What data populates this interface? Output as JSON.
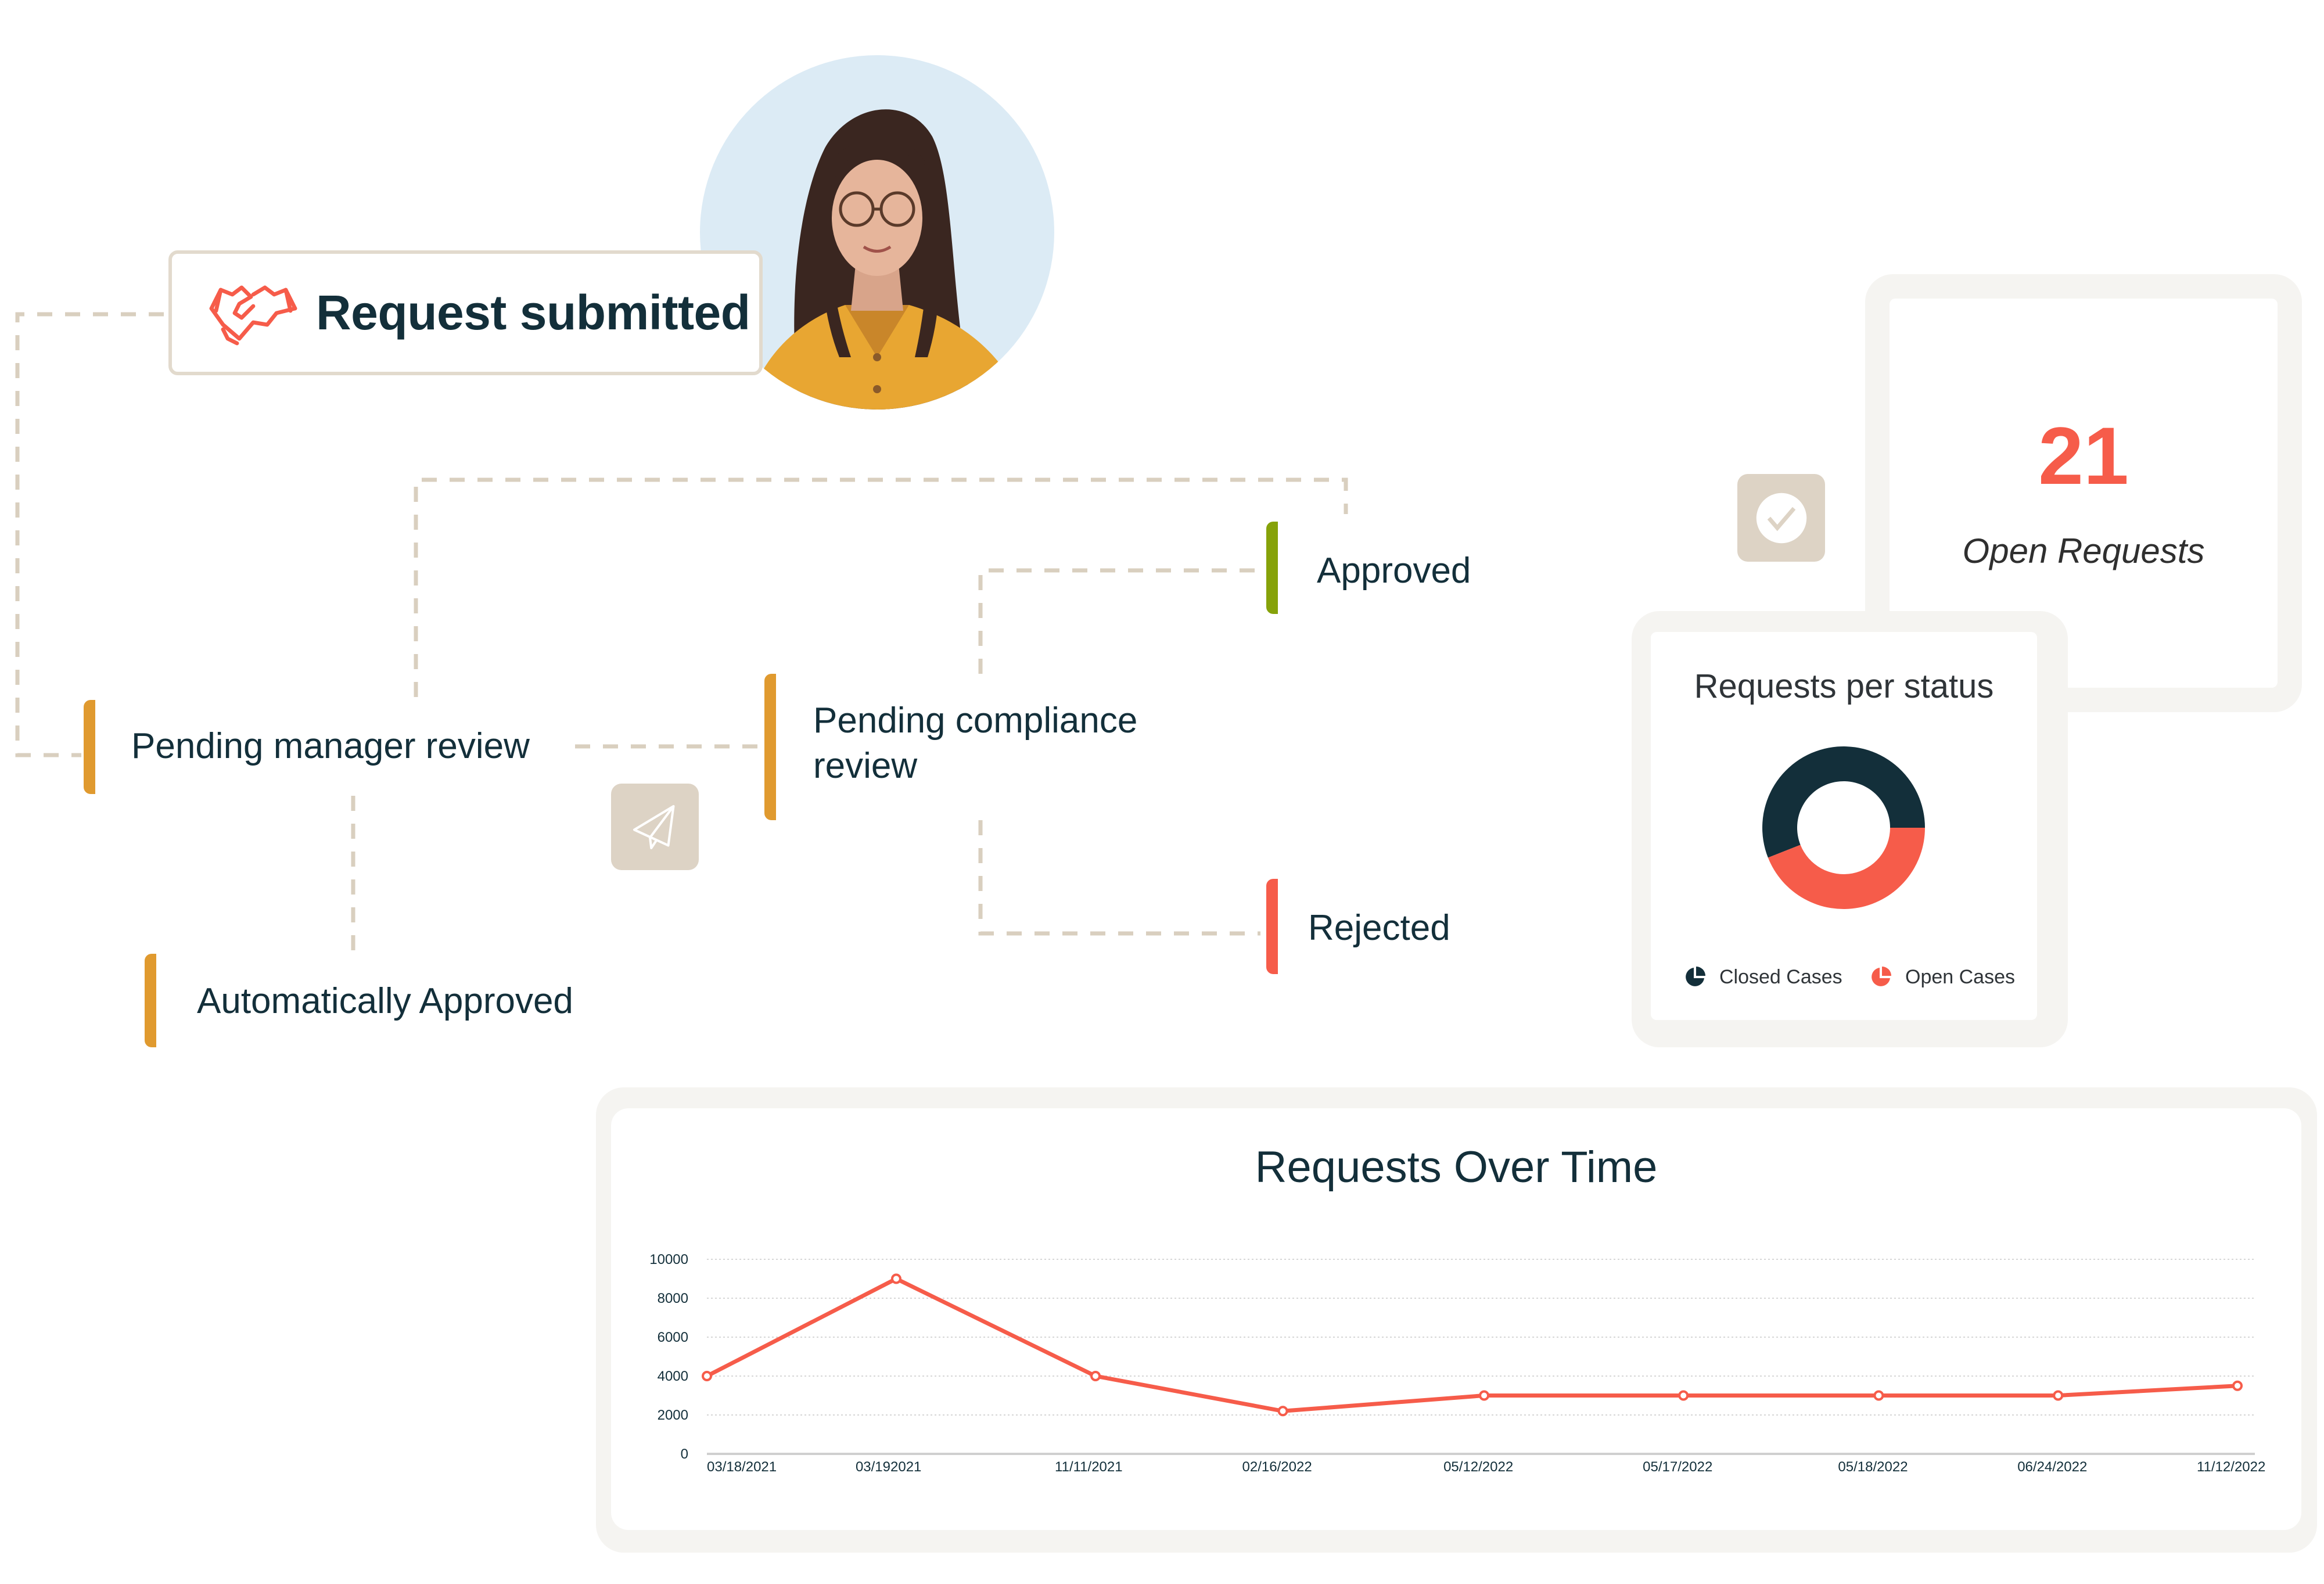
{
  "workflow": {
    "start": {
      "label": "Request submitted",
      "icon": "handshake-icon"
    },
    "stages": [
      {
        "id": "pending-manager-review",
        "label": "Pending manager review",
        "color": "#e09a2f"
      },
      {
        "id": "pending-compliance-review",
        "label_line1": "Pending compliance",
        "label_line2": "review",
        "color": "#e09a2f"
      },
      {
        "id": "approved",
        "label": "Approved",
        "color": "#86a20a"
      },
      {
        "id": "rejected",
        "label": "Rejected",
        "color": "#f65c4a"
      },
      {
        "id": "automatically-approved",
        "label": "Automatically Approved",
        "color": "#e09a2f"
      }
    ],
    "icons": {
      "send": "paper-plane-icon",
      "check": "check-circle-icon"
    }
  },
  "open_requests": {
    "count": "21",
    "label": "Open Requests",
    "accent": "#f65c4a"
  },
  "colors": {
    "dark": "#132f3a",
    "coral": "#f65c4a",
    "connector": "#d9cfbf",
    "tile": "#ddd3c5",
    "card_border": "#f5f4f1"
  },
  "chart_data": [
    {
      "type": "pie",
      "variant": "donut",
      "title": "Requests per status",
      "categories": [
        "Closed Cases",
        "Open Cases"
      ],
      "values": [
        56,
        44
      ],
      "unit": "percent (estimated)",
      "colors": [
        "#132f3a",
        "#f65c4a"
      ],
      "legend": "bottom"
    },
    {
      "type": "line",
      "title": "Requests Over Time",
      "xlabel": "",
      "ylabel": "",
      "categories": [
        "03/18/2021",
        "03/192021",
        "11/11/2021",
        "02/16/2022",
        "05/12/2022",
        "05/17/2022",
        "05/18/2022",
        "06/24/2022",
        "11/12/2022"
      ],
      "series": [
        {
          "name": "Requests",
          "values": [
            4000,
            9000,
            4000,
            2200,
            3000,
            3000,
            3000,
            3000,
            3500
          ],
          "color": "#f65c4a"
        }
      ],
      "ylim": [
        0,
        10000
      ],
      "yticks": [
        0,
        2000,
        4000,
        6000,
        8000,
        10000
      ],
      "grid": true,
      "legend": "none"
    }
  ]
}
